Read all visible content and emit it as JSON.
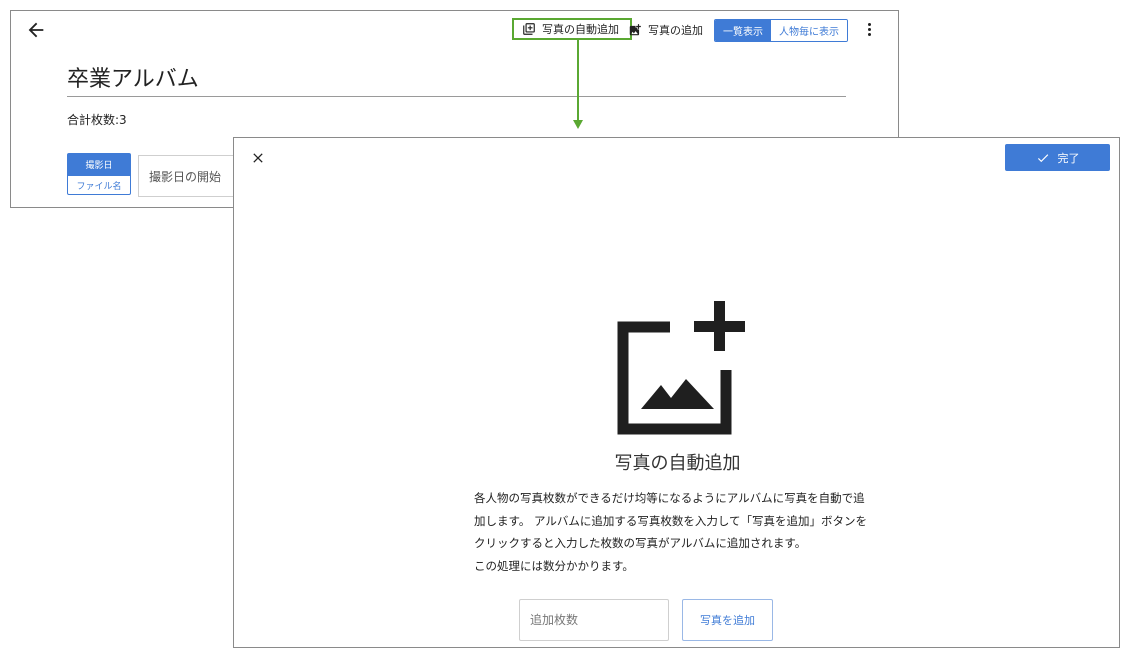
{
  "colors": {
    "accent": "#3f7bd6",
    "highlight": "#5aa832",
    "icon": "#1f1f1f"
  },
  "background_page": {
    "back_icon": "arrow-left-icon",
    "toolbar": {
      "auto_add_label": "写真の自動追加",
      "auto_add_icon": "auto-add-photo-icon",
      "add_photo_label": "写真の追加",
      "add_photo_icon": "add-photo-icon",
      "view_list_label": "一覧表示",
      "view_person_label": "人物毎に表示",
      "more_icon": "more-vert-icon"
    },
    "album_title": "卒業アルバム",
    "total_count": "合計枚数:3",
    "sort": {
      "active_label": "撮影日",
      "inactive_label": "ファイル名"
    },
    "date_start_placeholder": "撮影日の開始"
  },
  "dialog": {
    "close_icon": "close-icon",
    "done_label": "完了",
    "done_icon": "check-icon",
    "hero_icon": "add-photo-large-icon",
    "heading": "写真の自動追加",
    "description_lines": [
      "各人物の写真枚数ができるだけ均等になるようにアルバムに写真を自動で追",
      "加します。 アルバムに追加する写真枚数を入力して「写真を追加」ボタンを",
      "クリックすると入力した枚数の写真がアルバムに追加されます。",
      "この処理には数分かかります。"
    ],
    "count_input": {
      "placeholder": "追加枚数",
      "value": ""
    },
    "add_button_label": "写真を追加"
  }
}
